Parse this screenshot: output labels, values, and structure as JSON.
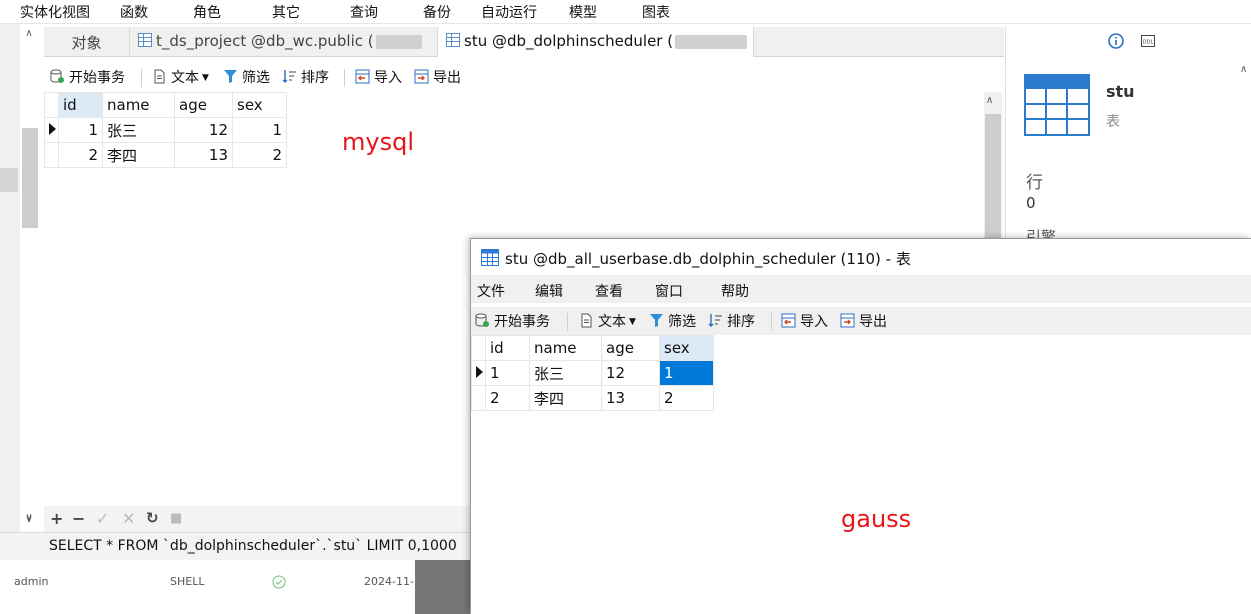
{
  "menubar": {
    "items": [
      "实体化视图",
      "函数",
      "角色",
      "其它",
      "查询",
      "备份",
      "自动运行",
      "模型",
      "图表"
    ]
  },
  "tabs": {
    "objects": "对象",
    "tab1": "t_ds_project @db_wc.public (",
    "tab2": "stu @db_dolphinscheduler ("
  },
  "mysql_toolbar": {
    "begin_tx": "开始事务",
    "text": "文本",
    "filter": "筛选",
    "sort": "排序",
    "import": "导入",
    "export": "导出"
  },
  "mysql_table": {
    "columns": [
      "id",
      "name",
      "age",
      "sex"
    ],
    "rows": [
      [
        "1",
        "张三",
        "12",
        "1"
      ],
      [
        "2",
        "李四",
        "13",
        "2"
      ]
    ]
  },
  "annotations": {
    "mysql": "mysql",
    "gauss": "gauss"
  },
  "right_panel": {
    "table_name": "stu",
    "table_type": "表",
    "rows_label": "行",
    "rows_value": "0",
    "partial_label": "引擎"
  },
  "sql_bar": {
    "query": "SELECT * FROM `db_dolphinscheduler`.`stu` LIMIT 0,1000"
  },
  "under_list": {
    "user": "admin",
    "type": "SHELL",
    "date": "2024-11-"
  },
  "gauss_window": {
    "title": "stu @db_all_userbase.db_dolphin_scheduler (110) - 表",
    "menu": [
      "文件",
      "编辑",
      "查看",
      "窗口",
      "帮助"
    ],
    "toolbar": {
      "begin_tx": "开始事务",
      "text": "文本",
      "filter": "筛选",
      "sort": "排序",
      "import": "导入",
      "export": "导出"
    },
    "table": {
      "columns": [
        "id",
        "name",
        "age",
        "sex"
      ],
      "rows": [
        [
          "1",
          "张三",
          "12",
          "1"
        ],
        [
          "2",
          "李四",
          "13",
          "2"
        ]
      ]
    }
  },
  "colors": {
    "accent_red": "#e8141a",
    "selection_blue": "#0078d7",
    "table_icon_blue": "#2b7bd1"
  }
}
